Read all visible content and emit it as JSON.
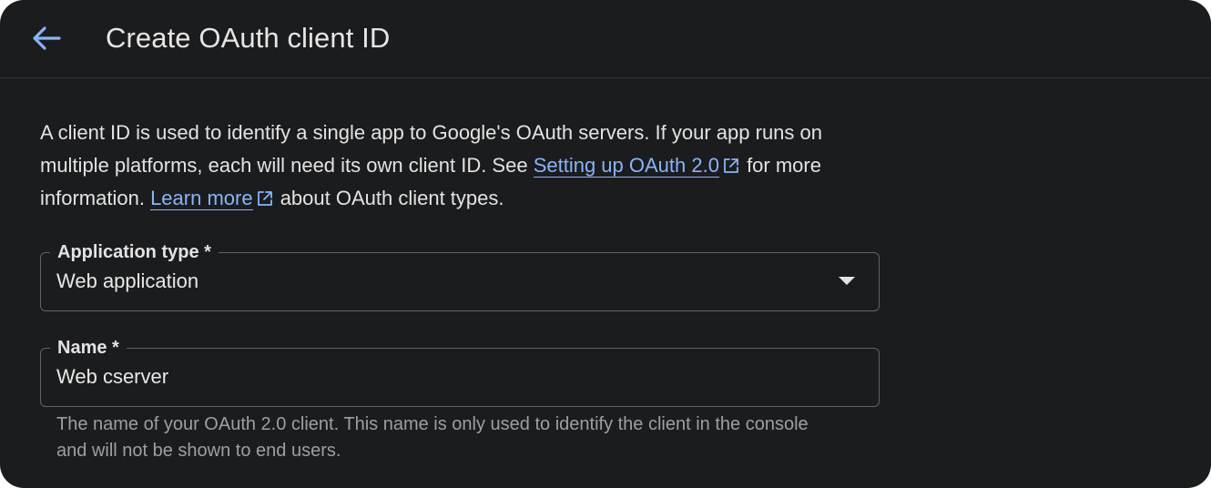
{
  "header": {
    "title": "Create OAuth client ID",
    "back_icon": "arrow-left-icon",
    "accent": "#8ab4f8"
  },
  "intro": {
    "part1": "A client ID is used to identify a single app to Google's OAuth servers. If your app runs on multiple platforms, each will need its own client ID. See ",
    "link1": "Setting up OAuth 2.0",
    "part2": " for more information. ",
    "link2": "Learn more",
    "part3": " about OAuth client types.",
    "external_icon": "open-in-new-icon"
  },
  "fields": {
    "application_type": {
      "label": "Application type *",
      "value": "Web application",
      "icon": "dropdown-arrow-icon"
    },
    "name": {
      "label": "Name *",
      "value": "Web cserver",
      "hint": "The name of your OAuth 2.0 client. This name is only used to identify the client in the console and will not be shown to end users."
    }
  }
}
